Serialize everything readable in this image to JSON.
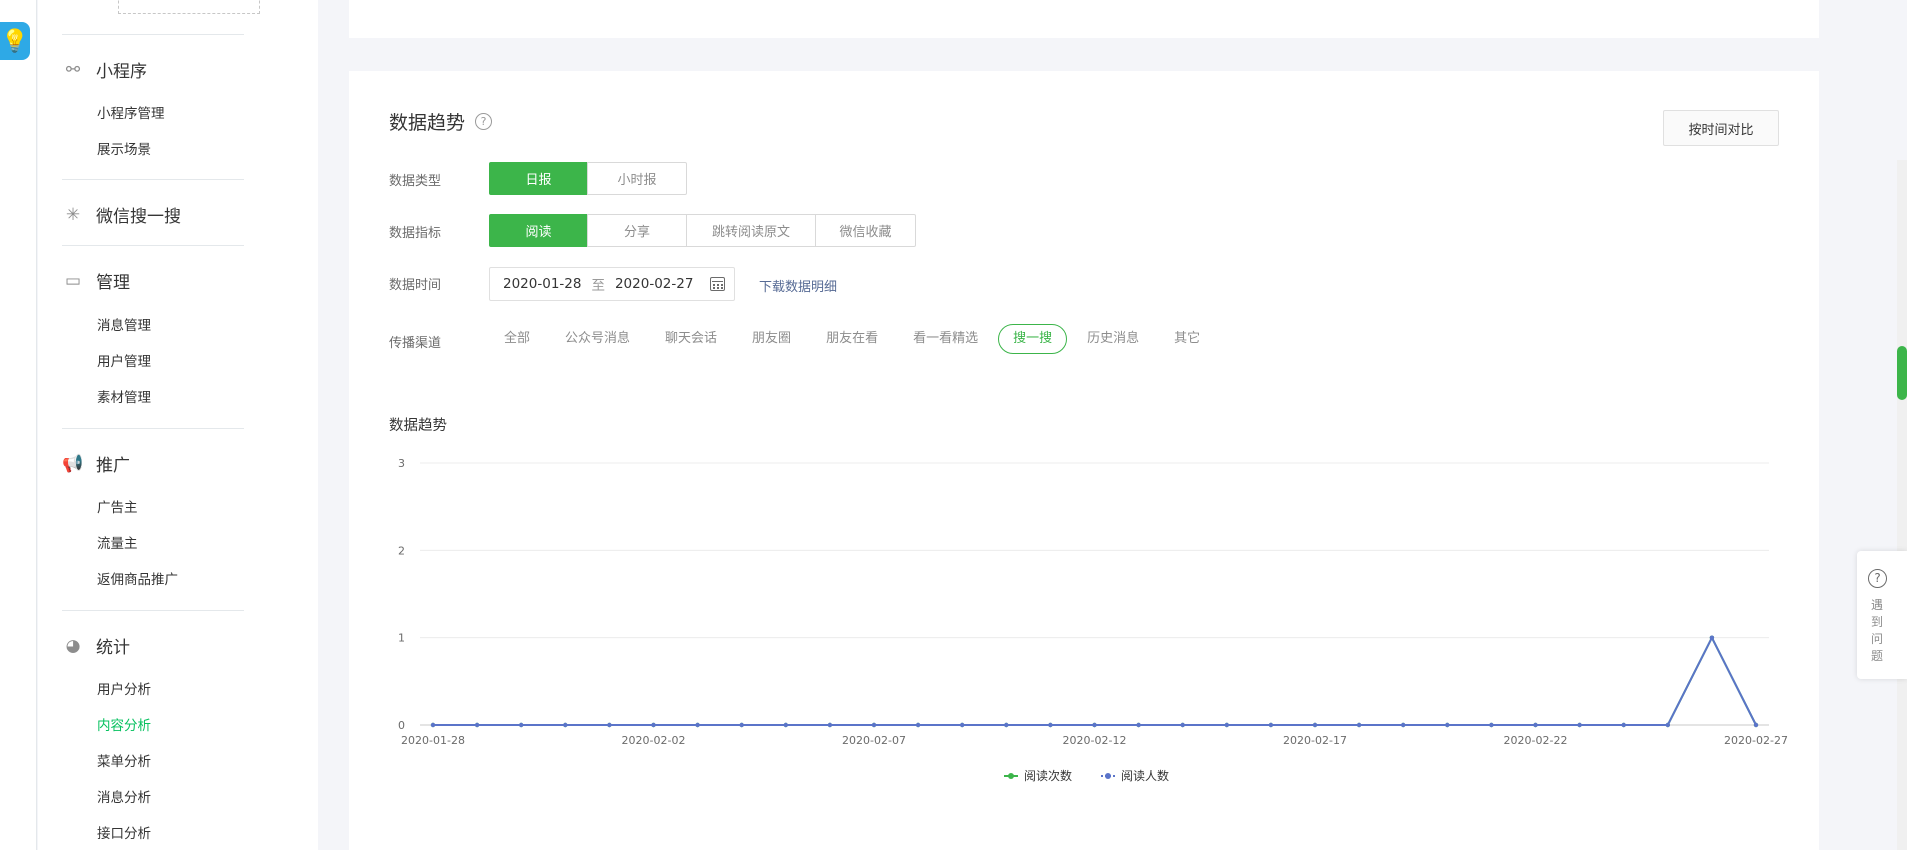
{
  "sidebar": {
    "groups": [
      {
        "title": "小程序",
        "icon": "link-icon",
        "items": [
          "小程序管理",
          "展示场景"
        ]
      },
      {
        "title": "微信搜一搜",
        "icon": "sparkle-icon",
        "items": []
      },
      {
        "title": "管理",
        "icon": "inbox-icon",
        "items": [
          "消息管理",
          "用户管理",
          "素材管理"
        ]
      },
      {
        "title": "推广",
        "icon": "megaphone-icon",
        "items": [
          "广告主",
          "流量主",
          "返佣商品推广"
        ]
      },
      {
        "title": "统计",
        "icon": "pie-chart-icon",
        "items": [
          "用户分析",
          "内容分析",
          "菜单分析",
          "消息分析",
          "接口分析"
        ]
      }
    ],
    "active_item": "内容分析"
  },
  "main": {
    "title": "数据趋势",
    "compare_button": "按时间对比",
    "data_type": {
      "label": "数据类型",
      "options": [
        "日报",
        "小时报"
      ],
      "selected": "日报"
    },
    "data_metric": {
      "label": "数据指标",
      "options": [
        "阅读",
        "分享",
        "跳转阅读原文",
        "微信收藏"
      ],
      "selected": "阅读"
    },
    "data_time": {
      "label": "数据时间",
      "start": "2020-01-28",
      "separator": "至",
      "end": "2020-02-27",
      "download_link": "下载数据明细"
    },
    "channel": {
      "label": "传播渠道",
      "options": [
        "全部",
        "公众号消息",
        "聊天会话",
        "朋友圈",
        "朋友在看",
        "看一看精选",
        "搜一搜",
        "历史消息",
        "其它"
      ],
      "selected": "搜一搜"
    },
    "chart_title": "数据趋势"
  },
  "help_float": {
    "text": "遇到问题"
  },
  "colors": {
    "accent": "#3cb54a",
    "series_reads": "#3cb54a",
    "series_readers": "#5b74c9",
    "link": "#576b95"
  },
  "chart_data": {
    "type": "line",
    "title": "数据趋势",
    "x": [
      "2020-01-28",
      "2020-01-29",
      "2020-01-30",
      "2020-01-31",
      "2020-02-01",
      "2020-02-02",
      "2020-02-03",
      "2020-02-04",
      "2020-02-05",
      "2020-02-06",
      "2020-02-07",
      "2020-02-08",
      "2020-02-09",
      "2020-02-10",
      "2020-02-11",
      "2020-02-12",
      "2020-02-13",
      "2020-02-14",
      "2020-02-15",
      "2020-02-16",
      "2020-02-17",
      "2020-02-18",
      "2020-02-19",
      "2020-02-20",
      "2020-02-21",
      "2020-02-22",
      "2020-02-23",
      "2020-02-24",
      "2020-02-25",
      "2020-02-26",
      "2020-02-27"
    ],
    "x_tick_labels": [
      "2020-01-28",
      "2020-02-02",
      "2020-02-07",
      "2020-02-12",
      "2020-02-17",
      "2020-02-22",
      "2020-02-27"
    ],
    "y_ticks": [
      0,
      1,
      2,
      3
    ],
    "ylim": [
      0,
      3
    ],
    "series": [
      {
        "name": "阅读次数",
        "values": [
          0,
          0,
          0,
          0,
          0,
          0,
          0,
          0,
          0,
          0,
          0,
          0,
          0,
          0,
          0,
          0,
          0,
          0,
          0,
          0,
          0,
          0,
          0,
          0,
          0,
          0,
          0,
          0,
          0,
          1,
          0
        ]
      },
      {
        "name": "阅读人数",
        "values": [
          0,
          0,
          0,
          0,
          0,
          0,
          0,
          0,
          0,
          0,
          0,
          0,
          0,
          0,
          0,
          0,
          0,
          0,
          0,
          0,
          0,
          0,
          0,
          0,
          0,
          0,
          0,
          0,
          0,
          1,
          0
        ]
      }
    ],
    "legend_position": "bottom-center",
    "grid": true
  }
}
